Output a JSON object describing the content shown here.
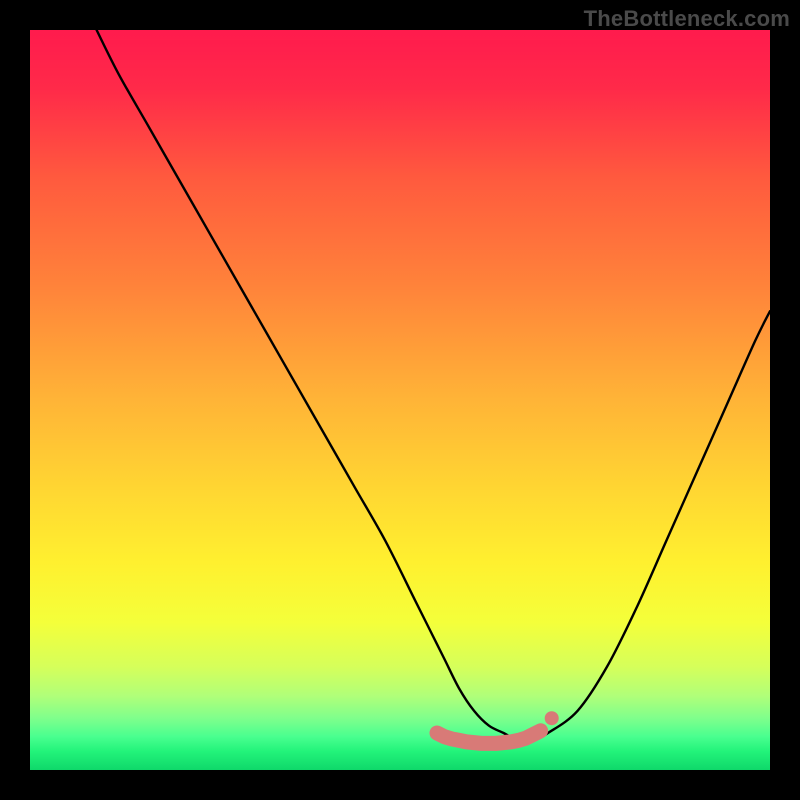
{
  "watermark": "TheBottleneck.com",
  "colors": {
    "frame": "#000000",
    "curve": "#000000",
    "marker_fill": "#d87a77",
    "marker_stroke": "#c86864",
    "gradient_stops": [
      {
        "offset": 0.0,
        "color": "#ff1b4d"
      },
      {
        "offset": 0.08,
        "color": "#ff2a49"
      },
      {
        "offset": 0.2,
        "color": "#ff5a3e"
      },
      {
        "offset": 0.35,
        "color": "#ff843a"
      },
      {
        "offset": 0.5,
        "color": "#ffb437"
      },
      {
        "offset": 0.62,
        "color": "#ffd632"
      },
      {
        "offset": 0.72,
        "color": "#fff02f"
      },
      {
        "offset": 0.8,
        "color": "#f4ff3a"
      },
      {
        "offset": 0.86,
        "color": "#d6ff5a"
      },
      {
        "offset": 0.9,
        "color": "#b0ff79"
      },
      {
        "offset": 0.93,
        "color": "#7fff8c"
      },
      {
        "offset": 0.955,
        "color": "#49ff8f"
      },
      {
        "offset": 0.975,
        "color": "#22f37a"
      },
      {
        "offset": 1.0,
        "color": "#0fd86a"
      }
    ]
  },
  "chart_data": {
    "type": "line",
    "title": "",
    "xlabel": "",
    "ylabel": "",
    "xlim": [
      0,
      100
    ],
    "ylim": [
      0,
      100
    ],
    "x": [
      9,
      12,
      16,
      20,
      24,
      28,
      32,
      36,
      40,
      44,
      48,
      52,
      54,
      56,
      58,
      60,
      62,
      64,
      66,
      68,
      70,
      74,
      78,
      82,
      86,
      90,
      94,
      98,
      100
    ],
    "values": [
      100,
      94,
      87,
      80,
      73,
      66,
      59,
      52,
      45,
      38,
      31,
      23,
      19,
      15,
      11,
      8,
      6,
      5,
      4,
      4,
      5,
      8,
      14,
      22,
      31,
      40,
      49,
      58,
      62
    ],
    "marker_points": [
      {
        "x": 55,
        "y": 5.0
      },
      {
        "x": 56,
        "y": 4.5
      },
      {
        "x": 57,
        "y": 4.2
      },
      {
        "x": 58,
        "y": 4.0
      },
      {
        "x": 59,
        "y": 3.8
      },
      {
        "x": 60,
        "y": 3.7
      },
      {
        "x": 61,
        "y": 3.6
      },
      {
        "x": 62,
        "y": 3.6
      },
      {
        "x": 63,
        "y": 3.6
      },
      {
        "x": 64,
        "y": 3.7
      },
      {
        "x": 65,
        "y": 3.8
      },
      {
        "x": 66,
        "y": 4.0
      },
      {
        "x": 67,
        "y": 4.3
      },
      {
        "x": 68,
        "y": 4.8
      },
      {
        "x": 69,
        "y": 5.3
      },
      {
        "x": 70.5,
        "y": 7.0
      }
    ]
  }
}
